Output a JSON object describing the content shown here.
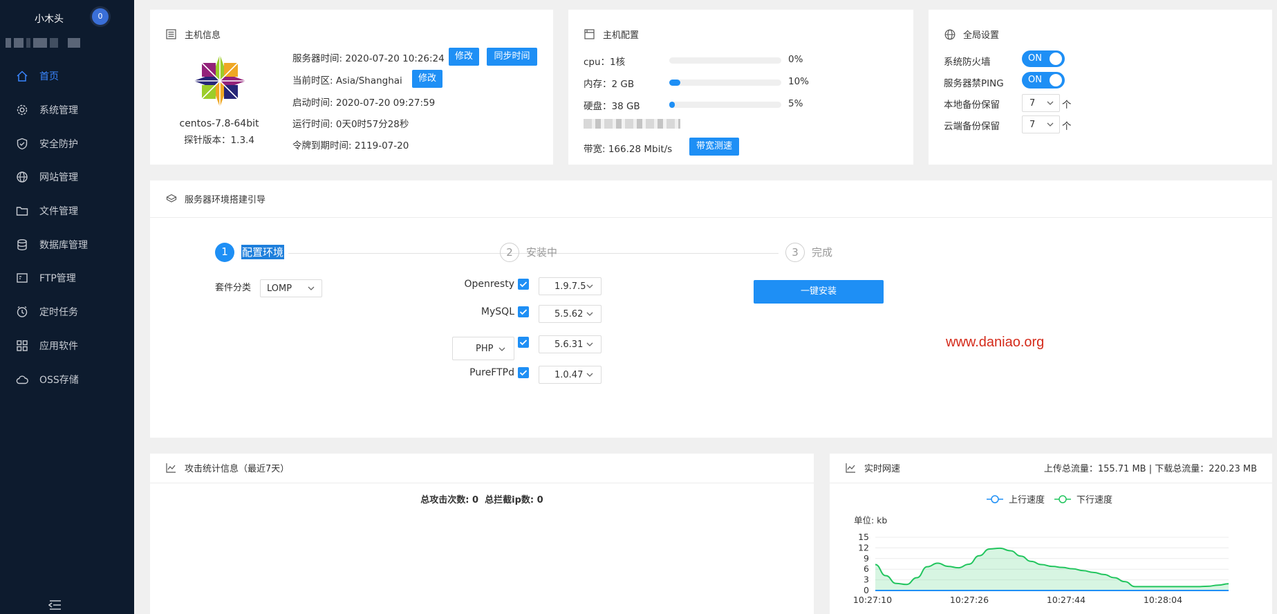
{
  "sidebar": {
    "username": "小木头",
    "badge": "0",
    "menu": [
      {
        "label": "首页",
        "icon": "home-icon",
        "active": true
      },
      {
        "label": "系统管理",
        "icon": "gear-icon"
      },
      {
        "label": "安全防护",
        "icon": "shield-icon"
      },
      {
        "label": "网站管理",
        "icon": "globe-icon"
      },
      {
        "label": "文件管理",
        "icon": "folder-icon"
      },
      {
        "label": "数据库管理",
        "icon": "database-icon"
      },
      {
        "label": "FTP管理",
        "icon": "ftp-icon"
      },
      {
        "label": "定时任务",
        "icon": "clock-icon"
      },
      {
        "label": "应用软件",
        "icon": "apps-icon"
      },
      {
        "label": "OSS存储",
        "icon": "cloud-icon"
      }
    ]
  },
  "host_info": {
    "title": "主机信息",
    "os": "centos-7.8-64bit",
    "probe_version": "探针版本：1.3.4",
    "server_time_label": "服务器时间:",
    "server_time": "2020-07-20 10:26:24",
    "edit_label": "修改",
    "sync_label": "同步时间",
    "timezone_label": "当前时区:",
    "timezone": "Asia/Shanghai",
    "boot_label": "启动时间:",
    "boot_time": "2020-07-20 09:27:59",
    "uptime_label": "运行时间:",
    "uptime": "0天0时57分28秒",
    "token_label": "令牌到期时间:",
    "token_expiry": "2119-07-20"
  },
  "host_config": {
    "title": "主机配置",
    "rows": [
      {
        "label": "cpu：1核",
        "percent": 0,
        "percent_text": "0%"
      },
      {
        "label": "内存：2 GB",
        "percent": 10,
        "percent_text": "10%"
      },
      {
        "label": "硬盘：38 GB",
        "percent": 5,
        "percent_text": "5%"
      }
    ],
    "bandwidth_label": "带宽: 166.28 Mbit/s",
    "speedtest_label": "带宽测速"
  },
  "global_settings": {
    "title": "全局设置",
    "firewall_label": "系统防火墙",
    "firewall_state": "ON",
    "ping_label": "服务器禁PING",
    "ping_state": "ON",
    "local_backup_label": "本地备份保留",
    "local_backup_value": "7",
    "cloud_backup_label": "云端备份保留",
    "cloud_backup_value": "7",
    "unit": "个"
  },
  "guide": {
    "title": "服务器环境搭建引导",
    "steps": [
      {
        "num": "1",
        "label": "配置环境",
        "active": true
      },
      {
        "num": "2",
        "label": "安装中",
        "active": false
      },
      {
        "num": "3",
        "label": "完成",
        "active": false
      }
    ],
    "suite_label": "套件分类",
    "suite_value": "LOMP",
    "packages": [
      {
        "name": "Openresty",
        "version": "1.9.7.5"
      },
      {
        "name": "MySQL",
        "version": "5.5.62"
      },
      {
        "name": "PHP",
        "version": "5.6.31"
      },
      {
        "name": "PureFTPd",
        "version": "1.0.47"
      }
    ],
    "install_label": "一键安装",
    "watermark": "www.daniao.org"
  },
  "attack_stats": {
    "title": "攻击统计信息（最近7天）",
    "summary_total_label": "总攻击次数:",
    "summary_total": "0",
    "summary_blocked_label": "总拦截ip数:",
    "summary_blocked": "0"
  },
  "net_speed": {
    "title": "实时网速",
    "totals": "上传总流量：155.71 MB | 下载总流量：220.23 MB",
    "unit_label": "单位: kb",
    "colors": {
      "upload": "#1e8ff5",
      "download": "#22c55e"
    }
  },
  "chart_data": {
    "type": "area",
    "title": "",
    "ylabel": "单位: kb",
    "ylim": [
      0,
      15
    ],
    "yticks": [
      0,
      3,
      6,
      9,
      12,
      15
    ],
    "x_labels": [
      "10:27:10",
      "10:27:26",
      "10:27:44",
      "10:28:04"
    ],
    "series": [
      {
        "name": "上行速度",
        "values": [
          0,
          0,
          0,
          0,
          0,
          0,
          0,
          0,
          0,
          0,
          0,
          0,
          0,
          0,
          0,
          0,
          0,
          0,
          0,
          0,
          0,
          0,
          0,
          0,
          0,
          0,
          0,
          0,
          0,
          0,
          0,
          0,
          0,
          0,
          0
        ]
      },
      {
        "name": "下行速度",
        "values": [
          7.3,
          4.2,
          2.0,
          1.7,
          3.6,
          6.7,
          7.7,
          6.8,
          6.4,
          7.4,
          9.8,
          11.7,
          11.9,
          11.2,
          9.7,
          8.2,
          7.3,
          6.8,
          6.5,
          6.1,
          5.6,
          5.1,
          4.5,
          3.6,
          2.5,
          1.1,
          1.1,
          1.1,
          1.1,
          1.1,
          1.1,
          1.1,
          1.2,
          1.5,
          1.9
        ]
      }
    ]
  }
}
